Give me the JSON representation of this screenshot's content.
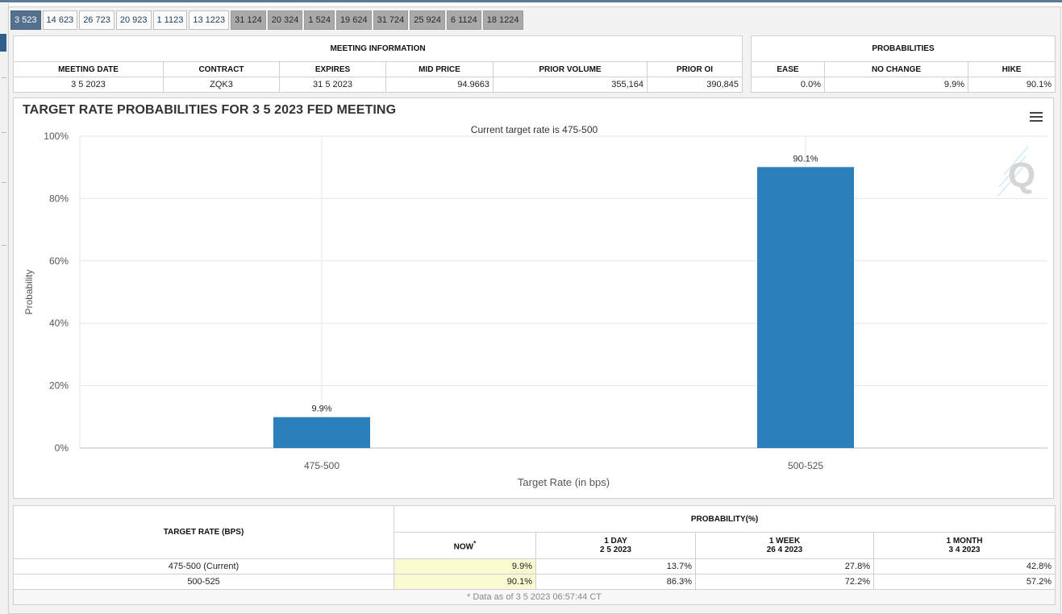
{
  "tabs": [
    "3 523",
    "14 623",
    "26 723",
    "20 923",
    "1 1123",
    "13 1223",
    "31 124",
    "20 324",
    "1 524",
    "19 624",
    "31 724",
    "25 924",
    "6 1124",
    "18 1224"
  ],
  "tab_active_index": 0,
  "tab_dim_from": 6,
  "meeting_info": {
    "title": "MEETING INFORMATION",
    "headers": [
      "MEETING DATE",
      "CONTRACT",
      "EXPIRES",
      "MID PRICE",
      "PRIOR VOLUME",
      "PRIOR OI"
    ],
    "values": [
      "3 5 2023",
      "ZQK3",
      "31 5 2023",
      "94.9663",
      "355,164",
      "390,845"
    ]
  },
  "probabilities": {
    "title": "PROBABILITIES",
    "headers": [
      "EASE",
      "NO CHANGE",
      "HIKE"
    ],
    "values": [
      "0.0%",
      "9.9%",
      "90.1%"
    ]
  },
  "chart_data": {
    "type": "bar",
    "title": "TARGET RATE PROBABILITIES FOR 3 5 2023 FED MEETING",
    "subtitle": "Current target rate is 475-500",
    "xlabel": "Target Rate (in bps)",
    "ylabel": "Probability",
    "categories": [
      "475-500",
      "500-525"
    ],
    "values": [
      9.9,
      90.1
    ],
    "data_labels": [
      "9.9%",
      "90.1%"
    ],
    "ylim": [
      0,
      100
    ],
    "yticks": [
      0,
      20,
      40,
      60,
      80,
      100
    ],
    "ytick_labels": [
      "0%",
      "20%",
      "40%",
      "60%",
      "80%",
      "100%"
    ],
    "grid": true,
    "bar_color": "#2b7fba"
  },
  "prob_table": {
    "target_header": "TARGET RATE (BPS)",
    "group_header": "PROBABILITY(%)",
    "columns": [
      {
        "label": "NOW",
        "mark": "*",
        "date": ""
      },
      {
        "label": "1 DAY",
        "mark": "",
        "date": "2 5 2023"
      },
      {
        "label": "1 WEEK",
        "mark": "",
        "date": "26 4 2023"
      },
      {
        "label": "1 MONTH",
        "mark": "",
        "date": "3 4 2023"
      }
    ],
    "rows": [
      {
        "rate": "475-500 (Current)",
        "values": [
          "9.9%",
          "13.7%",
          "27.8%",
          "42.8%"
        ]
      },
      {
        "rate": "500-525",
        "values": [
          "90.1%",
          "86.3%",
          "72.2%",
          "57.2%"
        ]
      }
    ],
    "footnote": "* Data as of 3 5 2023 06:57:44 CT"
  },
  "colors": {
    "accent": "#55708f",
    "bar": "#2b7fba",
    "now_highlight": "#fafad2"
  },
  "icons": {
    "menu": "hamburger-menu-icon",
    "logo": "q-logo-icon"
  }
}
